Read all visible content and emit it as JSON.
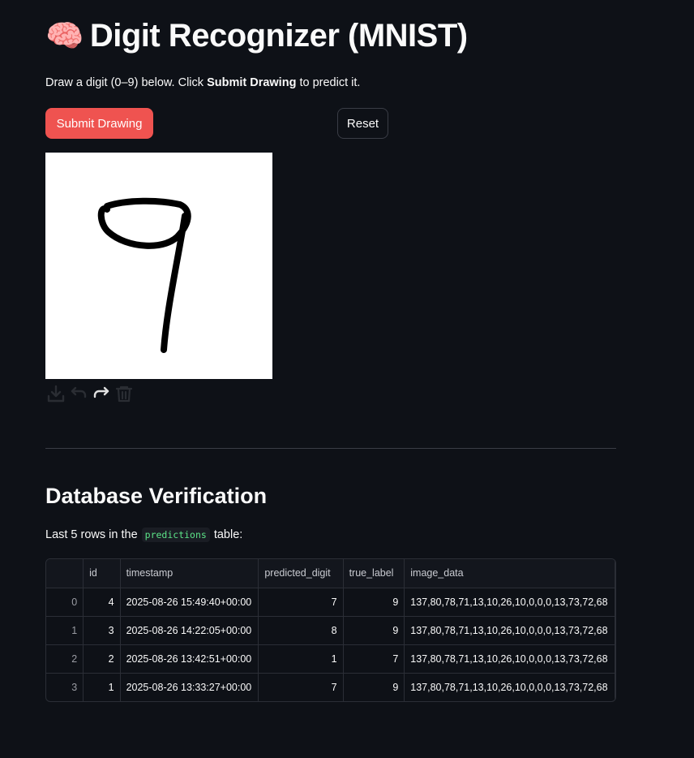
{
  "header": {
    "title_icon": "🧠",
    "title": "Digit Recognizer (MNIST)"
  },
  "intro": {
    "prefix": "Draw a digit (0–9) below. Click ",
    "bold": "Submit Drawing",
    "suffix": " to predict it."
  },
  "buttons": {
    "submit": "Submit Drawing",
    "reset": "Reset"
  },
  "canvas": {
    "toolbar_icons": [
      "download-icon",
      "undo-icon",
      "redo-icon",
      "trash-icon"
    ],
    "stroke_color": "#000000",
    "background": "#ffffff"
  },
  "section": {
    "title": "Database Verification",
    "caption_prefix": "Last 5 rows in the",
    "caption_code": "predictions",
    "caption_suffix": "table:"
  },
  "table": {
    "columns": [
      "",
      "id",
      "timestamp",
      "predicted_digit",
      "true_label",
      "image_data"
    ],
    "rows": [
      [
        "0",
        "4",
        "2025-08-26 15:49:40+00:00",
        "7",
        "9",
        "137,80,78,71,13,10,26,10,0,0,0,13,73,72,68"
      ],
      [
        "1",
        "3",
        "2025-08-26 14:22:05+00:00",
        "8",
        "9",
        "137,80,78,71,13,10,26,10,0,0,0,13,73,72,68"
      ],
      [
        "2",
        "2",
        "2025-08-26 13:42:51+00:00",
        "1",
        "7",
        "137,80,78,71,13,10,26,10,0,0,0,13,73,72,68"
      ],
      [
        "3",
        "1",
        "2025-08-26 13:33:27+00:00",
        "7",
        "9",
        "137,80,78,71,13,10,26,10,0,0,0,13,73,72,68"
      ]
    ]
  },
  "colors": {
    "background": "#0e1117",
    "primary_button": "#ef5350",
    "code_text": "#5ce488"
  }
}
